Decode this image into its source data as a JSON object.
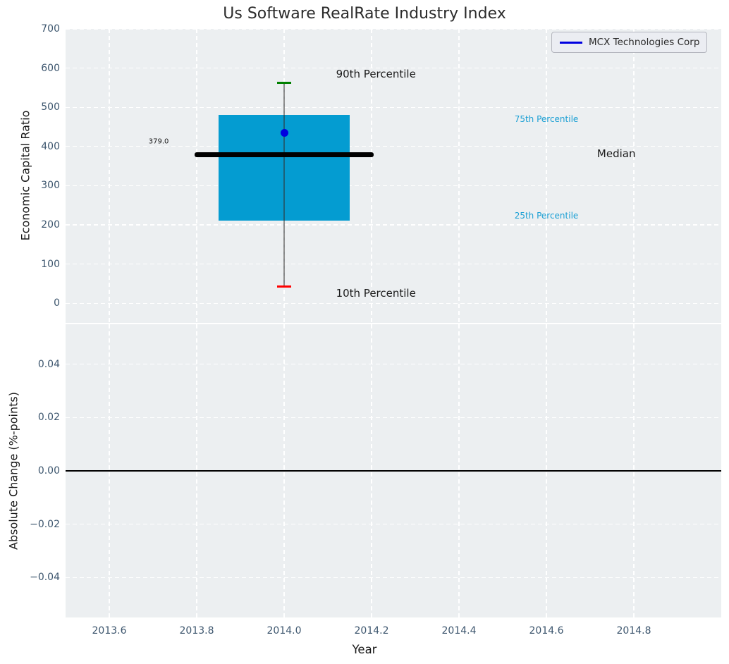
{
  "figure": {
    "title": "Us Software RealRate Industry Index",
    "background": "#ffffff",
    "panel_background": "#eceff1"
  },
  "legend": {
    "label": "MCX Technologies Corp",
    "line_color": "#0000e0"
  },
  "chart_data": {
    "type": "boxplot",
    "title": "Us Software RealRate Industry Index",
    "xlabel": "Year",
    "xlim": [
      2013.5,
      2015.0
    ],
    "xticks": [
      {
        "v": 2013.6,
        "label": "2013.6"
      },
      {
        "v": 2013.8,
        "label": "2013.8"
      },
      {
        "v": 2014.0,
        "label": "2014.0"
      },
      {
        "v": 2014.2,
        "label": "2014.2"
      },
      {
        "v": 2014.4,
        "label": "2014.4"
      },
      {
        "v": 2014.6,
        "label": "2014.6"
      },
      {
        "v": 2014.8,
        "label": "2014.8"
      }
    ],
    "grid": "white-dashed",
    "legend_position": "upper right",
    "panels": [
      {
        "id": "ratio",
        "ylabel": "Economic Capital Ratio",
        "ylim": [
          -50,
          700
        ],
        "yticks": [
          {
            "v": 0,
            "label": "0"
          },
          {
            "v": 100,
            "label": "100"
          },
          {
            "v": 200,
            "label": "200"
          },
          {
            "v": 300,
            "label": "300"
          },
          {
            "v": 400,
            "label": "400"
          },
          {
            "v": 500,
            "label": "500"
          },
          {
            "v": 600,
            "label": "600"
          },
          {
            "v": 700,
            "label": "700"
          }
        ],
        "boxplot": {
          "x": 2014.0,
          "box_halfwidth": 0.15,
          "median_halfwidth": 0.205,
          "cap_halfwidth": 0.016,
          "p10": 43,
          "p25": 211,
          "median": 379,
          "p75": 481,
          "p90": 563,
          "median_value_label": "379.0",
          "company_point": {
            "name": "MCX Technologies Corp",
            "x": 2014.0,
            "y": 435
          }
        },
        "annotations": [
          {
            "text": "90th Percentile",
            "x": 2014.21,
            "y": 584,
            "style": "black-md"
          },
          {
            "text": "75th Percentile",
            "x": 2014.6,
            "y": 470,
            "style": "cyan-sm"
          },
          {
            "text": "Median",
            "x": 2014.76,
            "y": 381,
            "style": "black-md"
          },
          {
            "text": "25th Percentile",
            "x": 2014.6,
            "y": 224,
            "style": "cyan-sm"
          },
          {
            "text": "10th Percentile",
            "x": 2014.21,
            "y": 26,
            "style": "black-md"
          },
          {
            "text": "379.0",
            "x": 2013.713,
            "y": 412,
            "style": "black-xs"
          }
        ]
      },
      {
        "id": "change",
        "ylabel": "Absolute Change (%-points)",
        "ylim": [
          -0.055,
          0.055
        ],
        "yticks": [
          {
            "v": 0.04,
            "label": "0.04"
          },
          {
            "v": 0.02,
            "label": "0.02"
          },
          {
            "v": 0.0,
            "label": "0.00"
          },
          {
            "v": -0.02,
            "label": "−0.02"
          },
          {
            "v": -0.04,
            "label": "−0.04"
          }
        ],
        "zero_line": 0.0
      }
    ]
  },
  "colors": {
    "box_fill": "#049cd1",
    "median_line": "#000000",
    "whisker": "rgba(50,50,50,0.55)",
    "cap_top": "#008000",
    "cap_bottom": "#ff0000",
    "company_dot": "#0000e0",
    "percentile_text": "#1a9fd4",
    "tick_text": "#3d566e",
    "grid": "#ffffff"
  }
}
